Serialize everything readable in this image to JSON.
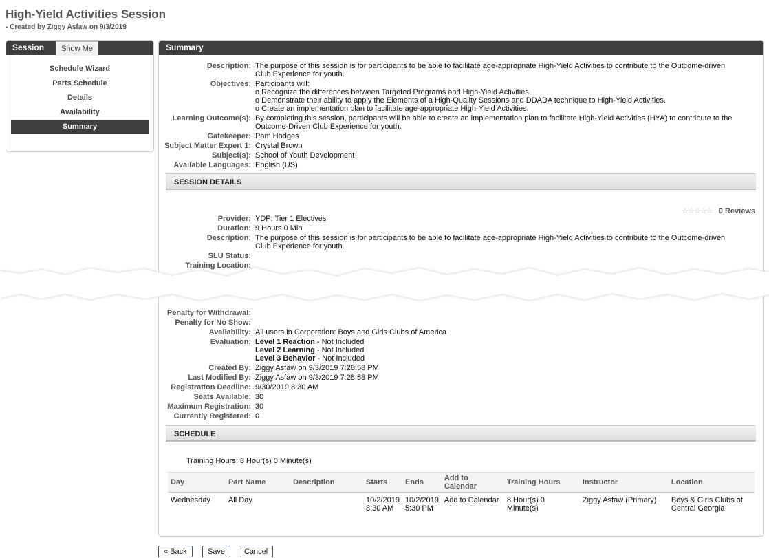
{
  "page": {
    "title": "High-Yield Activities Session",
    "subtitle": "- Created by Ziggy Asfaw on 9/3/2019"
  },
  "left": {
    "header": "Session",
    "show_me": "Show Me",
    "items": [
      "Schedule Wizard",
      "Parts Schedule",
      "Details",
      "Availability",
      "Summary"
    ],
    "active": "Summary"
  },
  "summary": {
    "header": "Summary",
    "description_label": "Description:",
    "description": "The purpose of this session is for participants to be able to facilitate age-appropriate High-Yield Activities to contribute to the Outcome-driven Club Experience for youth.",
    "objectives_label": "Objectives:",
    "objectives": [
      "Participants will:",
      "o Recognize the differences between Targeted Programs and High-Yield Activities",
      "o Demonstrate their ability to apply the Elements of a High-Quality Sessions and DDADA technique to High-Yield Activities.",
      "o Create an implementation plan to facilitate age-appropriate High-Yield Activities."
    ],
    "learning_outcome_label": "Learning Outcome(s):",
    "learning_outcome": "By completing this session, participants will be able to create an implementation plan to facilitate High-Yield Activities (HYA) to contribute to the Outcome-Driven Club Experience for youth.",
    "gatekeeper_label": "Gatekeeper:",
    "gatekeeper": "Pam Hodges",
    "sme_label": "Subject Matter Expert 1:",
    "sme": "Crystal Brown",
    "subjects_label": "Subject(s):",
    "subjects": "School of Youth Development",
    "languages_label": "Available Languages:",
    "languages": "English (US)"
  },
  "session_details": {
    "bar": "SESSION DETAILS",
    "reviews": "0 Reviews",
    "provider_label": "Provider:",
    "provider": "YDP: Tier 1 Electives",
    "duration_label": "Duration:",
    "duration": "9 Hours 0 Min",
    "description_label": "Description:",
    "description": "The purpose of this session is for participants to be able to facilitate age-appropriate High-Yield Activities to contribute to the Outcome-driven Club Experience for youth.",
    "slu_label": "SLU Status:",
    "location_label": "Training Location:",
    "penalty_withdrawal_label": "Penalty for Withdrawal:",
    "penalty_noshow_label": "Penalty for No Show:",
    "availability_label": "Availability:",
    "availability": "All users in Corporation: Boys and Girls Clubs of America",
    "evaluation_label": "Evaluation:",
    "evaluations": [
      {
        "name": "Level 1 Reaction",
        "status": " - Not Included"
      },
      {
        "name": "Level 2 Learning",
        "status": " - Not Included"
      },
      {
        "name": "Level 3 Behavior",
        "status": " - Not Included"
      }
    ],
    "created_by_label": "Created By:",
    "created_by": "Ziggy Asfaw on 9/3/2019 7:28:58 PM",
    "modified_label": "Last Modified By:",
    "modified": "Ziggy Asfaw on 9/3/2019 7:28:58 PM",
    "deadline_label": "Registration Deadline:",
    "deadline": "9/30/2019 8:30 AM",
    "seats_label": "Seats Available:",
    "seats": "30",
    "max_label": "Maximum Registration:",
    "max": "30",
    "registered_label": "Currently Registered:",
    "registered": "0"
  },
  "schedule": {
    "bar": "SCHEDULE",
    "training_hours": "Training Hours: 8 Hour(s) 0 Minute(s)",
    "columns": [
      "Day",
      "Part Name",
      "Description",
      "Starts",
      "Ends",
      "Add to Calendar",
      "Training Hours",
      "Instructor",
      "Location"
    ],
    "row": {
      "day": "Wednesday",
      "part": "All Day",
      "description": "",
      "starts_date": "10/2/2019",
      "starts_time": "8:30 AM",
      "ends_date": "10/2/2019",
      "ends_time": "5:30 PM",
      "add_to_calendar": "Add to Calendar",
      "hours": "8 Hour(s) 0 Minute(s)",
      "instructor": "Ziggy Asfaw (Primary)",
      "location": "Boys & Girls Clubs of Central Georgia"
    }
  },
  "buttons": {
    "back": "« Back",
    "save": "Save",
    "cancel": "Cancel"
  }
}
